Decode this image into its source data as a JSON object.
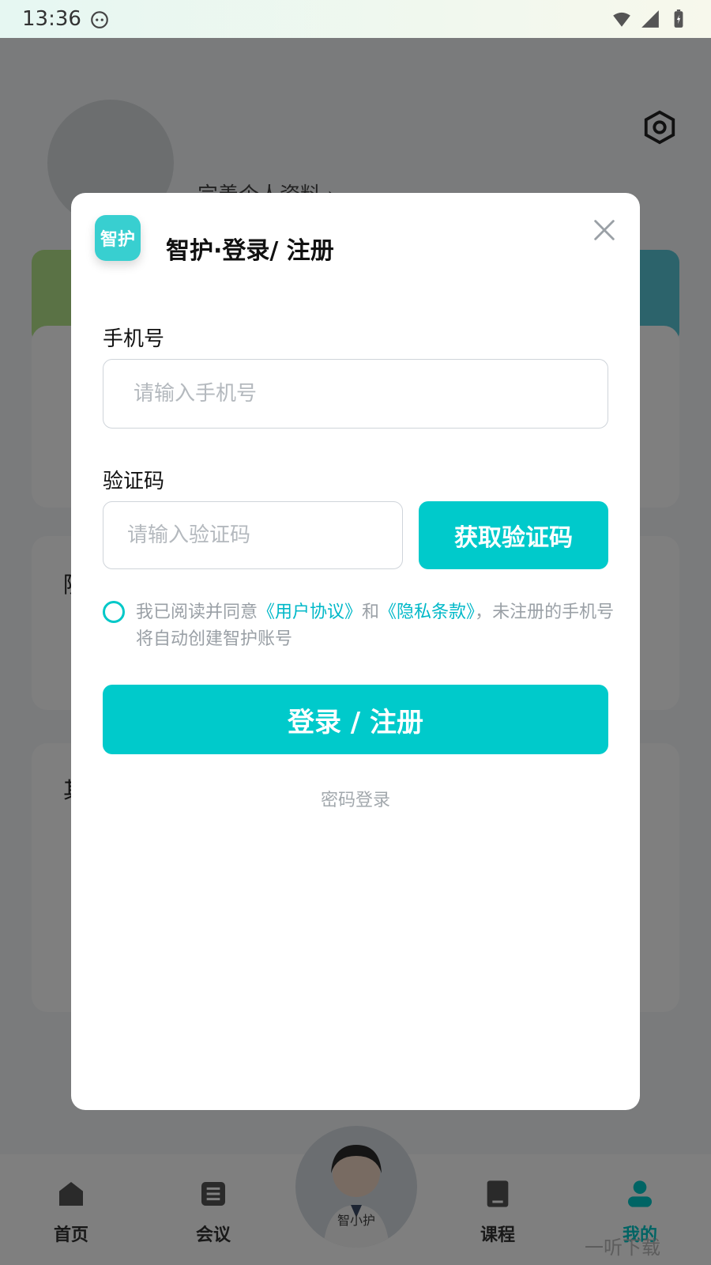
{
  "statusbar": {
    "time": "13:36"
  },
  "profile": {
    "complete_profile": "完善个人资料 ›"
  },
  "background": {
    "letter1": "院",
    "letter2": "其"
  },
  "nav": {
    "home": "首页",
    "meeting": "会议",
    "assistant": "智小护",
    "course": "课程",
    "mine": "我的"
  },
  "watermark": "一听下载",
  "modal": {
    "logo_text": "智护",
    "title": "智护·登录/ 注册",
    "phone_label": "手机号",
    "phone_placeholder": "请输入手机号",
    "code_label": "验证码",
    "code_placeholder": "请输入验证码",
    "get_code": "获取验证码",
    "agree_prefix": "我已阅读并同意",
    "user_agreement": "《用户协议》",
    "and": "和",
    "privacy": "《隐私条款》",
    "agree_suffix": "，未注册的手机号将自动创建智护账号",
    "login_button": "登录 / 注册",
    "password_login": "密码登录"
  },
  "colors": {
    "accent": "#00cacb",
    "overlay": "rgba(0,0,0,0.5)"
  }
}
